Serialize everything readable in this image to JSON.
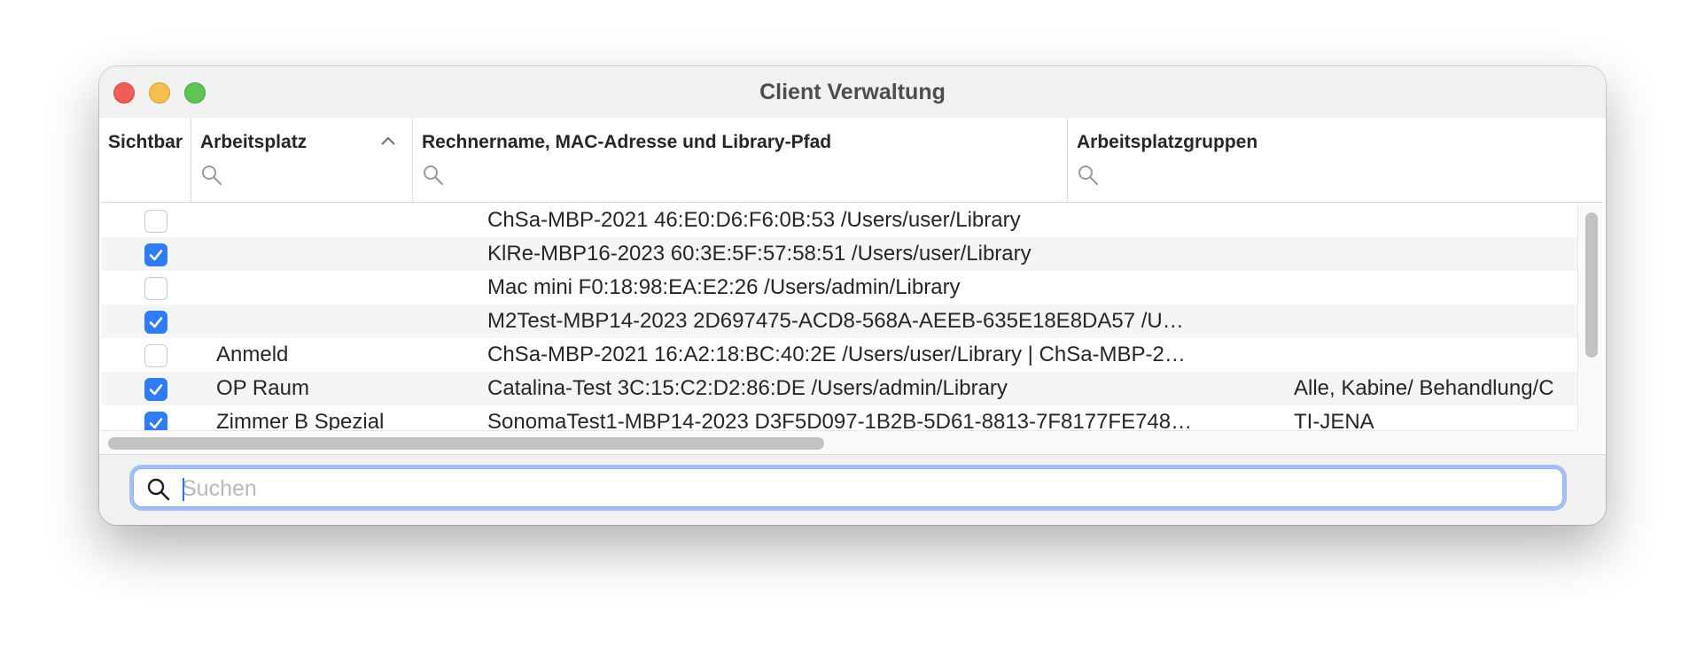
{
  "window": {
    "title": "Client Verwaltung"
  },
  "columns": [
    {
      "label": "Sichtbar"
    },
    {
      "label": "Arbeitsplatz"
    },
    {
      "label": "Rechnername, MAC-Adresse und Library-Pfad"
    },
    {
      "label": "Arbeitsplatzgruppen"
    }
  ],
  "rows": [
    {
      "visible": false,
      "arbeitsplatz": "",
      "rechner": "ChSa-MBP-2021 46:E0:D6:F6:0B:53 /Users/user/Library",
      "gruppen": ""
    },
    {
      "visible": true,
      "arbeitsplatz": "",
      "rechner": "KlRe-MBP16-2023 60:3E:5F:57:58:51 /Users/user/Library",
      "gruppen": ""
    },
    {
      "visible": false,
      "arbeitsplatz": "",
      "rechner": "Mac mini F0:18:98:EA:E2:26 /Users/admin/Library",
      "gruppen": ""
    },
    {
      "visible": true,
      "arbeitsplatz": "",
      "rechner": "M2Test-MBP14-2023 2D697475-ACD8-568A-AEEB-635E18E8DA57 /U…",
      "gruppen": ""
    },
    {
      "visible": false,
      "arbeitsplatz": "Anmeld",
      "rechner": "ChSa-MBP-2021 16:A2:18:BC:40:2E /Users/user/Library | ChSa-MBP-2…",
      "gruppen": ""
    },
    {
      "visible": true,
      "arbeitsplatz": "OP Raum",
      "rechner": "Catalina-Test 3C:15:C2:D2:86:DE /Users/admin/Library",
      "gruppen": "Alle, Kabine/ Behandlung/C"
    },
    {
      "visible": true,
      "arbeitsplatz": "Zimmer B Spezial",
      "rechner": "SonomaTest1-MBP14-2023 D3F5D097-1B2B-5D61-8813-7F8177FE748…",
      "gruppen": "TI-JENA"
    }
  ],
  "search": {
    "placeholder": "Suchen",
    "value": ""
  },
  "colors": {
    "accent": "#2f7cf6",
    "close": "#ee5e56",
    "minimize": "#f5bf4f",
    "maximize": "#60c454"
  },
  "icons": {
    "column_filter": "magnifier-icon",
    "sort": "chevron-up-icon",
    "search": "magnifier-icon"
  }
}
